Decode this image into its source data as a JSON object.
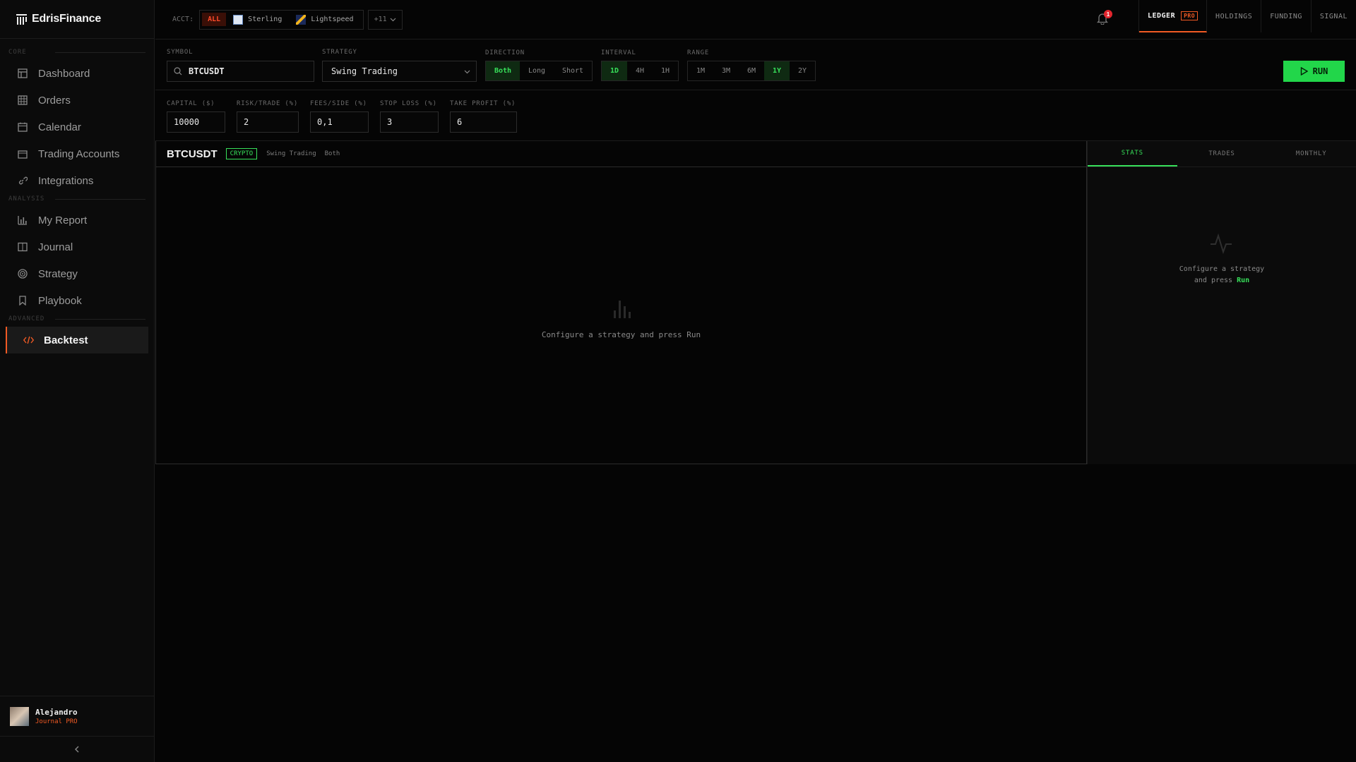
{
  "brand": {
    "name": "EdrisFinance"
  },
  "sidebar": {
    "sections": [
      {
        "label": "CORE",
        "items": [
          {
            "label": "Dashboard",
            "icon": "dashboard-icon"
          },
          {
            "label": "Orders",
            "icon": "grid-icon"
          },
          {
            "label": "Calendar",
            "icon": "calendar-icon"
          },
          {
            "label": "Trading Accounts",
            "icon": "folder-icon"
          },
          {
            "label": "Integrations",
            "icon": "link-icon"
          }
        ]
      },
      {
        "label": "ANALYSIS",
        "items": [
          {
            "label": "My Report",
            "icon": "bar-chart-icon"
          },
          {
            "label": "Journal",
            "icon": "book-icon"
          },
          {
            "label": "Strategy",
            "icon": "target-icon"
          },
          {
            "label": "Playbook",
            "icon": "bookmark-icon"
          }
        ]
      },
      {
        "label": "ADVANCED",
        "items": [
          {
            "label": "Backtest",
            "icon": "code-icon",
            "active": true
          }
        ]
      }
    ],
    "user": {
      "name": "Alejandro",
      "plan": "Journal PRO"
    }
  },
  "topbar": {
    "acct_label": "ACCT:",
    "all_label": "ALL",
    "accounts": [
      "Sterling",
      "Lightspeed"
    ],
    "more_label": "+11",
    "notifications": "1",
    "tabs": [
      {
        "label": "LEDGER",
        "badge": "PRO",
        "active": true
      },
      {
        "label": "HOLDINGS"
      },
      {
        "label": "FUNDING"
      },
      {
        "label": "SIGNAL"
      }
    ]
  },
  "controls": {
    "symbol": {
      "label": "SYMBOL",
      "value": "BTCUSDT"
    },
    "strategy": {
      "label": "STRATEGY",
      "value": "Swing Trading"
    },
    "direction": {
      "label": "DIRECTION",
      "options": [
        "Both",
        "Long",
        "Short"
      ],
      "selected": "Both"
    },
    "interval": {
      "label": "INTERVAL",
      "options": [
        "1D",
        "4H",
        "1H"
      ],
      "selected": "1D"
    },
    "range": {
      "label": "RANGE",
      "options": [
        "1M",
        "3M",
        "6M",
        "1Y",
        "2Y"
      ],
      "selected": "1Y"
    },
    "run_label": "RUN",
    "capital": {
      "label": "CAPITAL ($)",
      "value": "10000"
    },
    "risk": {
      "label": "RISK/TRADE (%)",
      "value": "2"
    },
    "fees": {
      "label": "FEES/SIDE (%)",
      "value": "0,1"
    },
    "stop": {
      "label": "STOP LOSS (%)",
      "value": "3"
    },
    "take": {
      "label": "TAKE PROFIT (%)",
      "value": "6"
    }
  },
  "main": {
    "symbol": "BTCUSDT",
    "badge": "CRYPTO",
    "strategy": "Swing Trading",
    "direction": "Both",
    "empty_text": "Configure a strategy and press Run"
  },
  "side": {
    "tabs": [
      "STATS",
      "TRADES",
      "MONTHLY"
    ],
    "active": "STATS",
    "empty_line1": "Configure a strategy",
    "empty_line2": "and press",
    "empty_run": "Run"
  },
  "colors": {
    "accent": "#f15a24",
    "positive": "#37e05a",
    "run": "#22d64a"
  }
}
